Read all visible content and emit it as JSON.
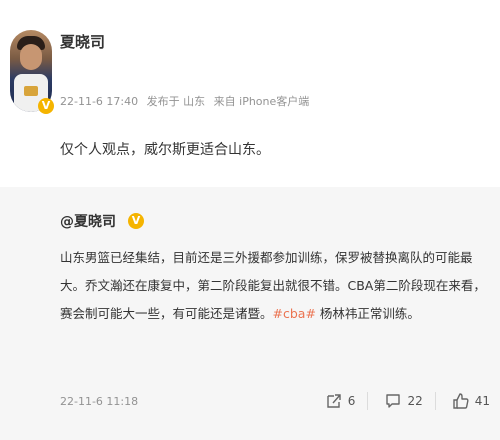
{
  "post": {
    "username": "夏晓司",
    "verified_badge": "V",
    "time": "22-11-6 17:40",
    "location_label": "发布于 山东",
    "source_label": "来自 iPhone客户端",
    "text": "仅个人观点，威尔斯更适合山东。"
  },
  "repost": {
    "mention": "@夏晓司",
    "verified_badge": "V",
    "text_before_tag": "山东男篮已经集结，目前还是三外援都参加训练，保罗被替换离队的可能最大。乔文瀚还在康复中，第二阶段能复出就很不错。CBA第二阶段现在来看，赛会制可能大一些，有可能还是诸暨。",
    "hashtag": "#cba#",
    "text_after_tag": " 杨林祎正常训练。",
    "time": "22-11-6 11:18",
    "actions": {
      "share_count": "6",
      "comment_count": "22",
      "like_count": "41"
    }
  },
  "icons": {
    "share": "share-icon",
    "comment": "comment-icon",
    "like": "thumbs-up-icon"
  },
  "colors": {
    "hashtag": "#eb7350",
    "verified": "#f5b400",
    "meta_text": "#939393",
    "repost_background": "#f6f6f6"
  }
}
